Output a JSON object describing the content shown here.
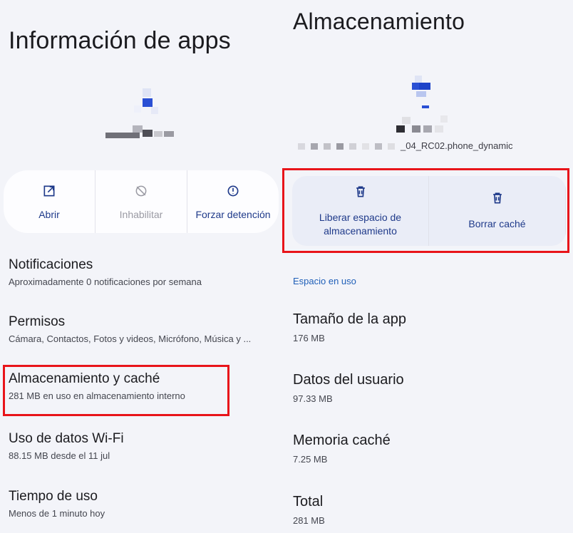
{
  "left": {
    "title": "Información de apps",
    "actions": [
      {
        "label": "Abrir",
        "icon": "open-external-icon"
      },
      {
        "label": "Inhabilitar",
        "icon": "disable-icon"
      },
      {
        "label": "Forzar detención",
        "icon": "alert-icon"
      }
    ],
    "items": [
      {
        "title": "Notificaciones",
        "subtitle": "Aproximadamente 0 notificaciones por semana"
      },
      {
        "title": "Permisos",
        "subtitle": "Cámara, Contactos, Fotos y videos, Micrófono, Música y ..."
      },
      {
        "title": "Almacenamiento y caché",
        "subtitle": "281 MB en uso en almacenamiento interno"
      },
      {
        "title": "Uso de datos Wi-Fi",
        "subtitle": "88.15 MB desde el 11 jul"
      },
      {
        "title": "Tiempo de uso",
        "subtitle": "Menos de 1 minuto hoy"
      }
    ]
  },
  "right": {
    "title": "Almacenamiento",
    "package_suffix": "_04_RC02.phone_dynamic",
    "actions": [
      {
        "label_line1": "Liberar espacio de",
        "label_line2": "almacenamiento",
        "icon": "trash-icon"
      },
      {
        "label": "Borrar caché",
        "icon": "trash-icon"
      }
    ],
    "section_label": "Espacio en uso",
    "stats": [
      {
        "title": "Tamaño de la app",
        "value": "176 MB"
      },
      {
        "title": "Datos del usuario",
        "value": "97.33 MB"
      },
      {
        "title": "Memoria caché",
        "value": "7.25 MB"
      },
      {
        "title": "Total",
        "value": "281 MB"
      }
    ]
  },
  "colors": {
    "background": "#f3f4f9",
    "accent": "#1f3a8a",
    "highlight_box": "#e8141a",
    "section_label": "#1f5fb8"
  }
}
